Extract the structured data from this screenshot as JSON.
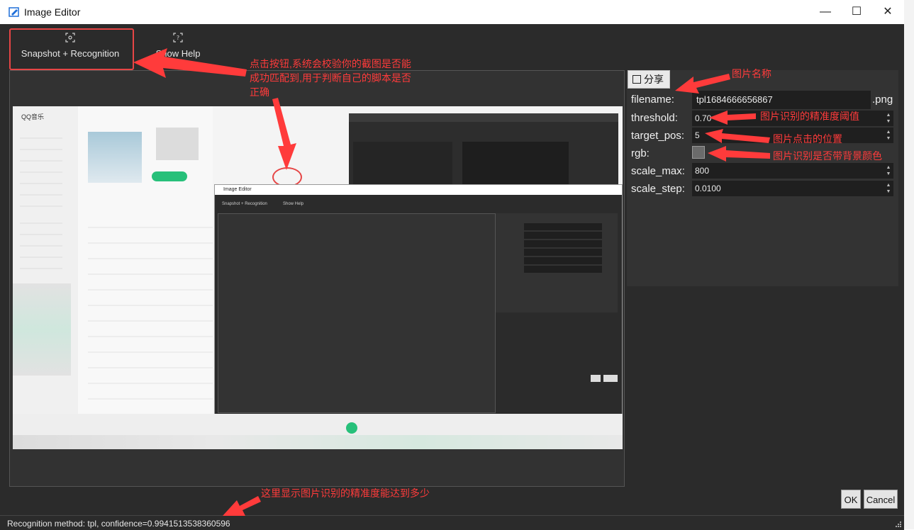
{
  "window": {
    "title": "Image Editor",
    "minimize": "—",
    "maximize": "☐",
    "close": "✕"
  },
  "toolbar": {
    "snapshot_label": "Snapshot + Recognition",
    "help_label": "Show Help"
  },
  "panel": {
    "share_label": "分享",
    "filename_label": "filename:",
    "filename_value": "tpl1684666656867",
    "filename_suffix": ".png",
    "threshold_label": "threshold:",
    "threshold_value": "0.70",
    "target_pos_label": "target_pos:",
    "target_pos_value": "5",
    "rgb_label": "rgb:",
    "scale_max_label": "scale_max:",
    "scale_max_value": "800",
    "scale_step_label": "scale_step:",
    "scale_step_value": "0.0100"
  },
  "buttons": {
    "ok": "OK",
    "cancel": "Cancel"
  },
  "status": {
    "text": "Recognition method: tpl, confidence=0.9941513538360596"
  },
  "annotations": {
    "button_note_1": "点击按钮,系统会校验你的截图是否能",
    "button_note_2": "成功匹配到,用于判断自己的脚本是否",
    "button_note_3": "正确",
    "filename_note": "图片名称",
    "threshold_note": "图片识别的精准度阈值",
    "target_pos_note": "图片点击的位置",
    "rgb_note": "图片识别是否带背景颜色",
    "status_note": "这里显示图片识别的精准度能达到多少"
  },
  "embedded": {
    "app_name": "QQ音乐",
    "editor_title": "Image Editor",
    "inner_snapshot": "Snapshot + Recognition",
    "inner_help": "Show Help"
  },
  "colors": {
    "annotation": "#ff3b3b",
    "highlight_box": "#e64545",
    "window_bg": "#2b2b2b"
  }
}
